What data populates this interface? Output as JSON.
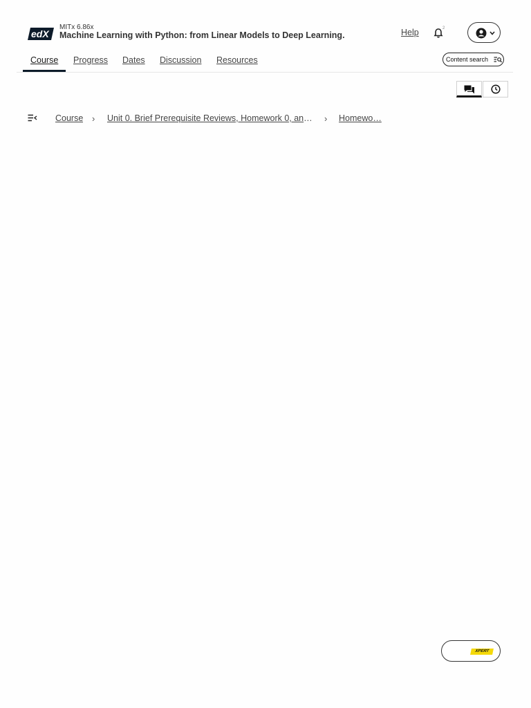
{
  "header": {
    "logo_text": "edX",
    "course_org": "MITx 6.86x",
    "course_title": "Machine Learning with Python: from Linear Models to Deep Learning.",
    "help_label": "Help",
    "notification_count": "2"
  },
  "tabs": [
    {
      "label": "Course",
      "active": true
    },
    {
      "label": "Progress",
      "active": false
    },
    {
      "label": "Dates",
      "active": false
    },
    {
      "label": "Discussion",
      "active": false
    },
    {
      "label": "Resources",
      "active": false
    }
  ],
  "content_search": {
    "label": "Content search"
  },
  "breadcrumb": {
    "items": [
      {
        "label": "Course"
      },
      {
        "label": "Unit 0. Brief Prerequisite Reviews, Homework 0, and…"
      },
      {
        "label": "Homewo…"
      }
    ]
  },
  "xpert": {
    "label": "XPERT"
  },
  "colors": {
    "accent": "#0d1b2a",
    "xpert_yellow": "#f5d90a"
  }
}
